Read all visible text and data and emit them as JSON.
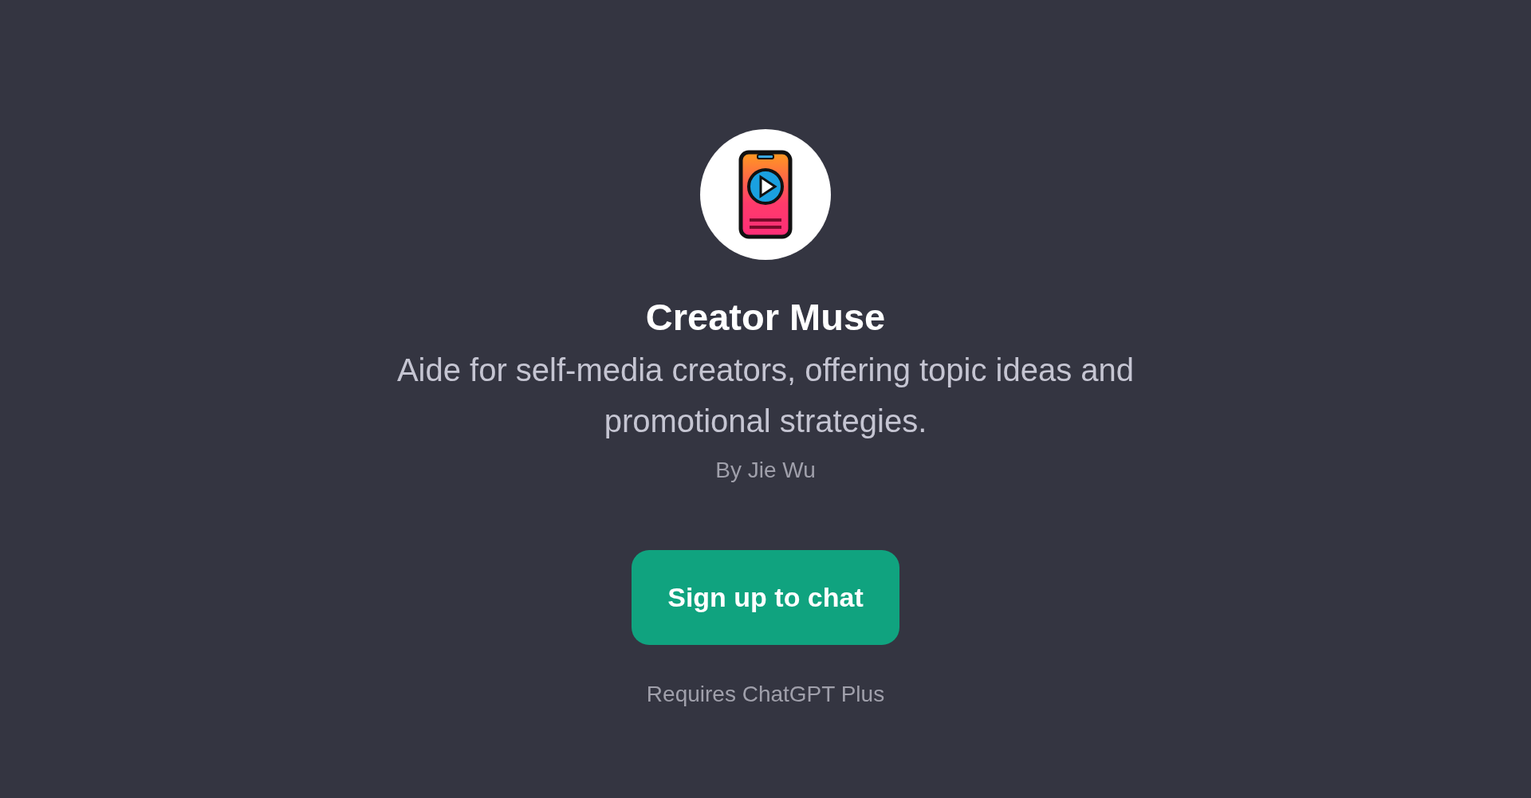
{
  "title": "Creator Muse",
  "description": "Aide for self-media creators, offering topic ideas and promotional strategies.",
  "author": "By Jie Wu",
  "button": "Sign up to chat",
  "footnote": "Requires ChatGPT Plus"
}
